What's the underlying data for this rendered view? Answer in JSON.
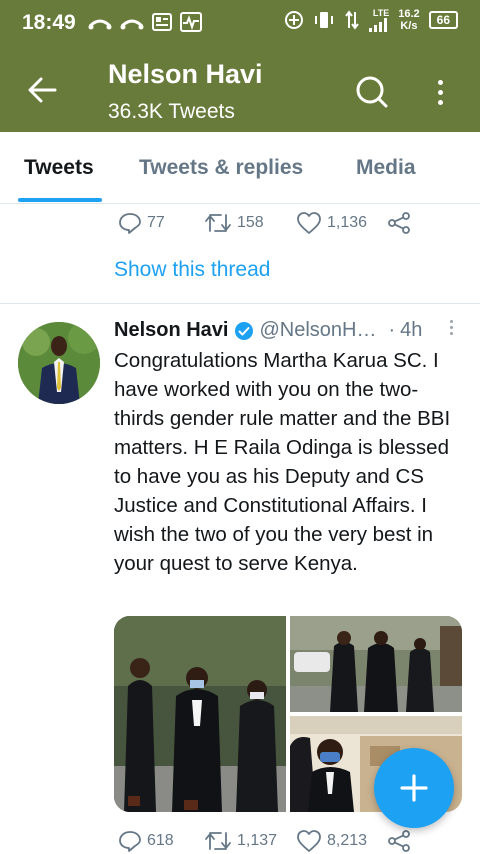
{
  "status_bar": {
    "time": "18:49",
    "network_label": "LTE",
    "speed_value": "16.2",
    "speed_unit": "K/s",
    "battery": "66"
  },
  "header": {
    "name": "Nelson Havi",
    "tweet_count": "36.3K Tweets"
  },
  "tabs": [
    {
      "label": "Tweets",
      "active": true
    },
    {
      "label": "Tweets & replies",
      "active": false
    },
    {
      "label": "Media",
      "active": false
    }
  ],
  "previous_tweet": {
    "replies": "77",
    "retweets": "158",
    "likes": "1,136",
    "show_thread": "Show this thread"
  },
  "tweet": {
    "author": "Nelson Havi",
    "handle": "@NelsonH…",
    "separator": "·",
    "time": "4h",
    "text": "Congratulations Martha Karua SC. I have worked with you on the two-thirds gender rule matter and the BBI matters. H E Raila Odinga is blessed to have you as his Deputy and CS Justice and Constitutional Affairs. I wish the two of you the very best in your quest to serve Kenya.",
    "replies": "618",
    "retweets": "1,137",
    "likes": "8,213"
  },
  "colors": {
    "brand_bar": "#687b3a",
    "accent_blue": "#1da1f2",
    "secondary_text": "#657786"
  }
}
